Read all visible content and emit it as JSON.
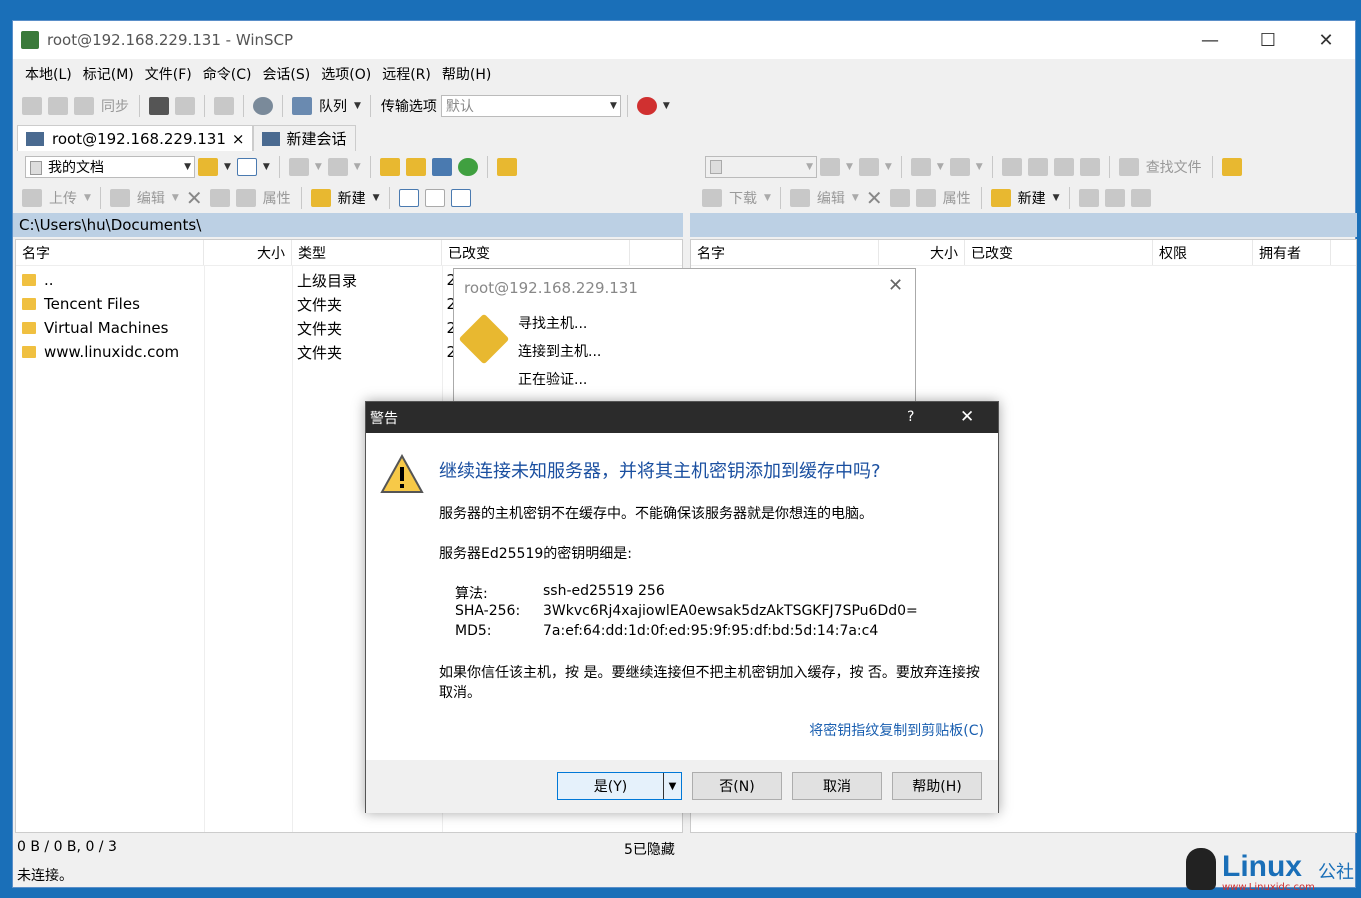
{
  "window": {
    "title": "root@192.168.229.131 - WinSCP"
  },
  "menu": [
    "本地(L)",
    "标记(M)",
    "文件(F)",
    "命令(C)",
    "会话(S)",
    "选项(O)",
    "远程(R)",
    "帮助(H)"
  ],
  "toolbar": {
    "sync": "同步",
    "queue": "队列",
    "transfer_label": "传输选项",
    "transfer_value": "默认"
  },
  "tabs": {
    "session": "root@192.168.229.131",
    "session_close": "×",
    "new_session": "新建会话"
  },
  "left": {
    "location": "我的文档",
    "upload": "上传",
    "edit": "编辑",
    "properties": "属性",
    "new": "新建",
    "path": "C:\\Users\\hu\\Documents\\",
    "columns": [
      "名字",
      "大小",
      "类型",
      "已改变"
    ],
    "rows": [
      {
        "name": "..",
        "type": "上级目录",
        "changed": "2"
      },
      {
        "name": "Tencent Files",
        "type": "文件夹",
        "changed": "2"
      },
      {
        "name": "Virtual Machines",
        "type": "文件夹",
        "changed": "2"
      },
      {
        "name": "www.linuxidc.com",
        "type": "文件夹",
        "changed": "2"
      }
    ]
  },
  "right": {
    "find": "查找文件",
    "download": "下载",
    "edit": "编辑",
    "properties": "属性",
    "new": "新建",
    "columns": [
      "名字",
      "大小",
      "已改变",
      "权限",
      "拥有者"
    ]
  },
  "connecting": {
    "title": "root@192.168.229.131",
    "steps": [
      "寻找主机...",
      "连接到主机...",
      "正在验证..."
    ]
  },
  "dialog": {
    "title": "警告",
    "help_q": "?",
    "question": "继续连接未知服务器，并将其主机密钥添加到缓存中吗?",
    "line1": "服务器的主机密钥不在缓存中。不能确保该服务器就是你想连的电脑。",
    "line2": "服务器Ed25519的密钥明细是:",
    "algo_label": "算法:",
    "algo": "ssh-ed25519 256",
    "sha_label": "SHA-256:",
    "sha": "3Wkvc6Rj4xajiowlEA0ewsak5dzAkTSGKFJ7SPu6Dd0=",
    "md5_label": "MD5:",
    "md5": "7a:ef:64:dd:1d:0f:ed:95:9f:95:df:bd:5d:14:7a:c4",
    "line3": "如果你信任该主机，按 是。要继续连接但不把主机密钥加入缓存，按 否。要放弃连接按 取消。",
    "copy_link": "将密钥指纹复制到剪贴板(C)",
    "buttons": {
      "yes": "是(Y)",
      "no": "否(N)",
      "cancel": "取消",
      "help": "帮助(H)"
    }
  },
  "status": {
    "bytes": "0 B / 0 B,  0 / 3",
    "hidden": "5已隐藏",
    "conn": "未连接。"
  },
  "watermark": {
    "brand": "Linux",
    "suffix": "公社",
    "url": "www.Linuxidc.com"
  }
}
